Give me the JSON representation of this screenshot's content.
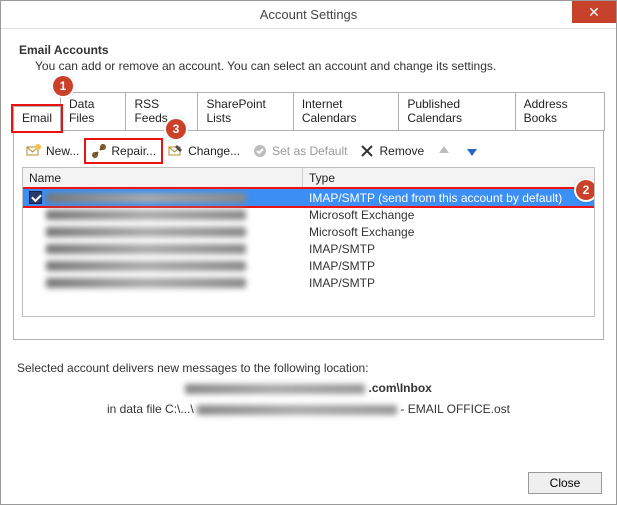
{
  "window": {
    "title": "Account Settings",
    "close_glyph": "✕"
  },
  "header": {
    "title": "Email Accounts",
    "subtitle": "You can add or remove an account. You can select an account and change its settings."
  },
  "callouts": {
    "tab": "1",
    "repair": "3",
    "row": "2"
  },
  "tabs": [
    {
      "label": "Email",
      "active": true,
      "highlight": true
    },
    {
      "label": "Data Files"
    },
    {
      "label": "RSS Feeds"
    },
    {
      "label": "SharePoint Lists"
    },
    {
      "label": "Internet Calendars"
    },
    {
      "label": "Published Calendars"
    },
    {
      "label": "Address Books"
    }
  ],
  "toolbar": {
    "new_label": "New...",
    "repair_label": "Repair...",
    "change_label": "Change...",
    "set_default_label": "Set as Default",
    "remove_label": "Remove"
  },
  "list": {
    "headers": {
      "name": "Name",
      "type": "Type"
    },
    "rows": [
      {
        "name_obscured": true,
        "type": "IMAP/SMTP (send from this account by default)",
        "selected": true,
        "default_icon": true
      },
      {
        "name_obscured": true,
        "type": "Microsoft Exchange"
      },
      {
        "name_obscured": true,
        "type": "Microsoft Exchange"
      },
      {
        "name_obscured": true,
        "type": "IMAP/SMTP"
      },
      {
        "name_obscured": true,
        "type": "IMAP/SMTP"
      },
      {
        "name_obscured": true,
        "type": "IMAP/SMTP"
      }
    ]
  },
  "delivery": {
    "line1": "Selected account delivers new messages to the following location:",
    "path_suffix": ".com\\Inbox",
    "line3_prefix": "in data file C:\\...\\",
    "line3_suffix": " - EMAIL OFFICE.ost"
  },
  "footer": {
    "close_label": "Close"
  }
}
